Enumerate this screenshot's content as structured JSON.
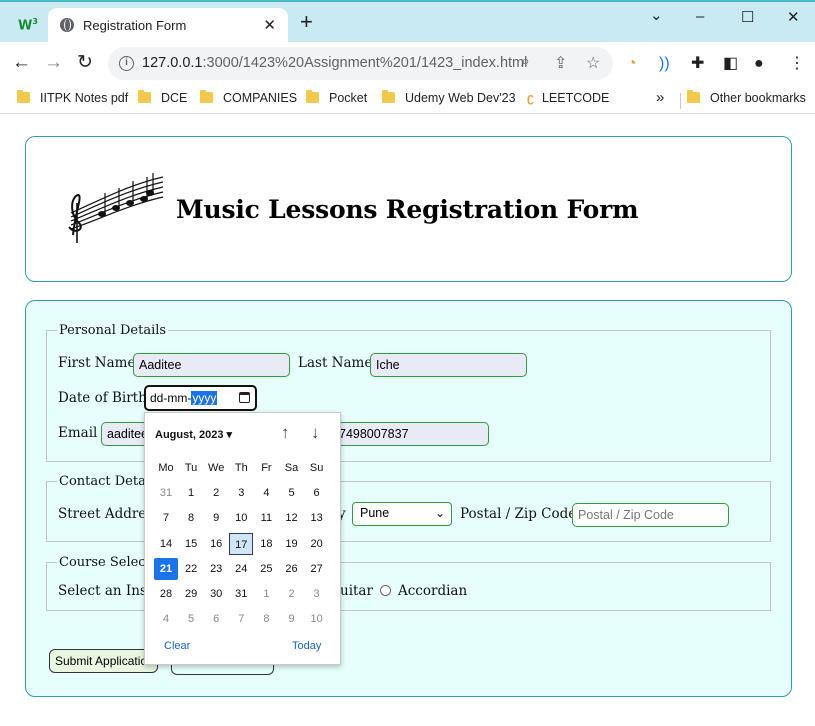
{
  "browser": {
    "tab_title": "Registration Form",
    "tab_close": "✕",
    "new_tab": "+",
    "url_host": "127.0.0.1",
    "url_path": ":3000/1423%20Assignment%201/1423_index.html",
    "window_controls": {
      "minimize": "–",
      "maximize": "☐",
      "close": "✕"
    },
    "bookmarks": [
      "IITPK Notes pdf",
      "DCE",
      "COMPANIES",
      "Pocket",
      "Udemy Web Dev'23",
      "LEETCODE"
    ],
    "bookmarks_overflow": "»",
    "other_bookmarks": "Other bookmarks"
  },
  "page": {
    "title": "Music Lessons Registration Form",
    "personal": {
      "legend": "Personal Details",
      "first_name_label": "First Name",
      "first_name_value": "Aaditee",
      "last_name_label": "Last Name",
      "last_name_value": "Iche",
      "dob_label": "Date of Birth",
      "dob_dd": "dd",
      "dob_mm": "mm",
      "dob_yyyy": "yyyy",
      "email_label": "Email",
      "email_value_visible": "aaditee",
      "phone_value_visible": "7498007837"
    },
    "contact": {
      "legend_visible": "Contact Detail",
      "street_label_visible": "Street Address",
      "city_label_tail": "y",
      "city_selected": "Pune",
      "postal_label": "Postal / Zip Code",
      "postal_placeholder": "Postal / Zip Code"
    },
    "course": {
      "legend_visible": "Course Selecti",
      "instrument_label_visible": "Select an Instr",
      "guitar_tail": "uitar",
      "accordian_label": "Accordian"
    },
    "buttons": {
      "submit_visible": "Submit Applicatio"
    }
  },
  "datepicker": {
    "month_label": "August, 2023 ▾",
    "weekdays": [
      "Mo",
      "Tu",
      "We",
      "Th",
      "Fr",
      "Sa",
      "Su"
    ],
    "weeks": [
      [
        "31",
        "1",
        "2",
        "3",
        "4",
        "5",
        "6"
      ],
      [
        "7",
        "8",
        "9",
        "10",
        "11",
        "12",
        "13"
      ],
      [
        "14",
        "15",
        "16",
        "17",
        "18",
        "19",
        "20"
      ],
      [
        "21",
        "22",
        "23",
        "24",
        "25",
        "26",
        "27"
      ],
      [
        "28",
        "29",
        "30",
        "31",
        "1",
        "2",
        "3"
      ],
      [
        "4",
        "5",
        "6",
        "7",
        "8",
        "9",
        "10"
      ]
    ],
    "today_day": "17",
    "selected_day": "21",
    "clear_label": "Clear",
    "today_label": "Today"
  },
  "colors": {
    "tab_strip": "#c9eaf3",
    "page_border": "#2f9fa5",
    "form_background": "#e6fffd",
    "input_border": "#2e9e3e",
    "picker_selected": "#1a73e8",
    "picker_today": "#cfe5fb"
  }
}
